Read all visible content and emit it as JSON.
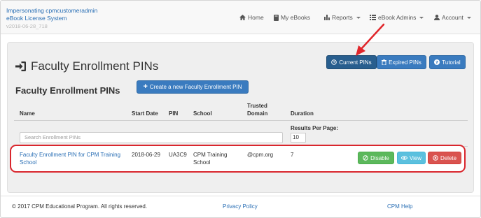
{
  "header": {
    "impersonating": "Impersonating cpmcustomeradmin",
    "system": "eBook License System",
    "version": "v2018-06-28_718",
    "nav": {
      "home": "Home",
      "my_ebooks": "My eBooks",
      "reports": "Reports",
      "ebook_admins": "eBook Admins",
      "account": "Account"
    }
  },
  "page": {
    "title": "Faculty Enrollment PINs",
    "section_title": "Faculty Enrollment PINs",
    "create_button": "Create a new Faculty Enrollment PIN",
    "buttons": {
      "current": "Current PINs",
      "expired": "Expired PINs",
      "tutorial": "Tutorial"
    }
  },
  "table": {
    "headers": {
      "name": "Name",
      "start_date": "Start Date",
      "pin": "PIN",
      "school": "School",
      "trusted_domain_1": "Trusted",
      "trusted_domain_2": "Domain",
      "duration": "Duration"
    },
    "search_placeholder": "Search Enrollment PINs",
    "results_per_page_label": "Results Per Page:",
    "results_per_page_value": "10",
    "rows": [
      {
        "name_line1": "Faculty Enrollment PIN for CPM Training",
        "name_line2": "School",
        "start_date": "2018-06-29",
        "pin": "UA3C9",
        "school_line1": "CPM Training",
        "school_line2": "School",
        "trusted_domain": "@cpm.org",
        "duration": "7",
        "actions": {
          "disable": "Disable",
          "view": "View",
          "delete": "Delete"
        }
      }
    ]
  },
  "footer": {
    "copyright": "© 2017 CPM Educational Program. All rights reserved.",
    "privacy": "Privacy Policy",
    "help": "CPM Help"
  },
  "colors": {
    "link": "#2a6fb5",
    "primary": "#3a7bbf",
    "active": "#285e8e",
    "success": "#5cb85c",
    "info": "#5bc0de",
    "danger": "#d9534f",
    "highlight": "#d9262d"
  }
}
